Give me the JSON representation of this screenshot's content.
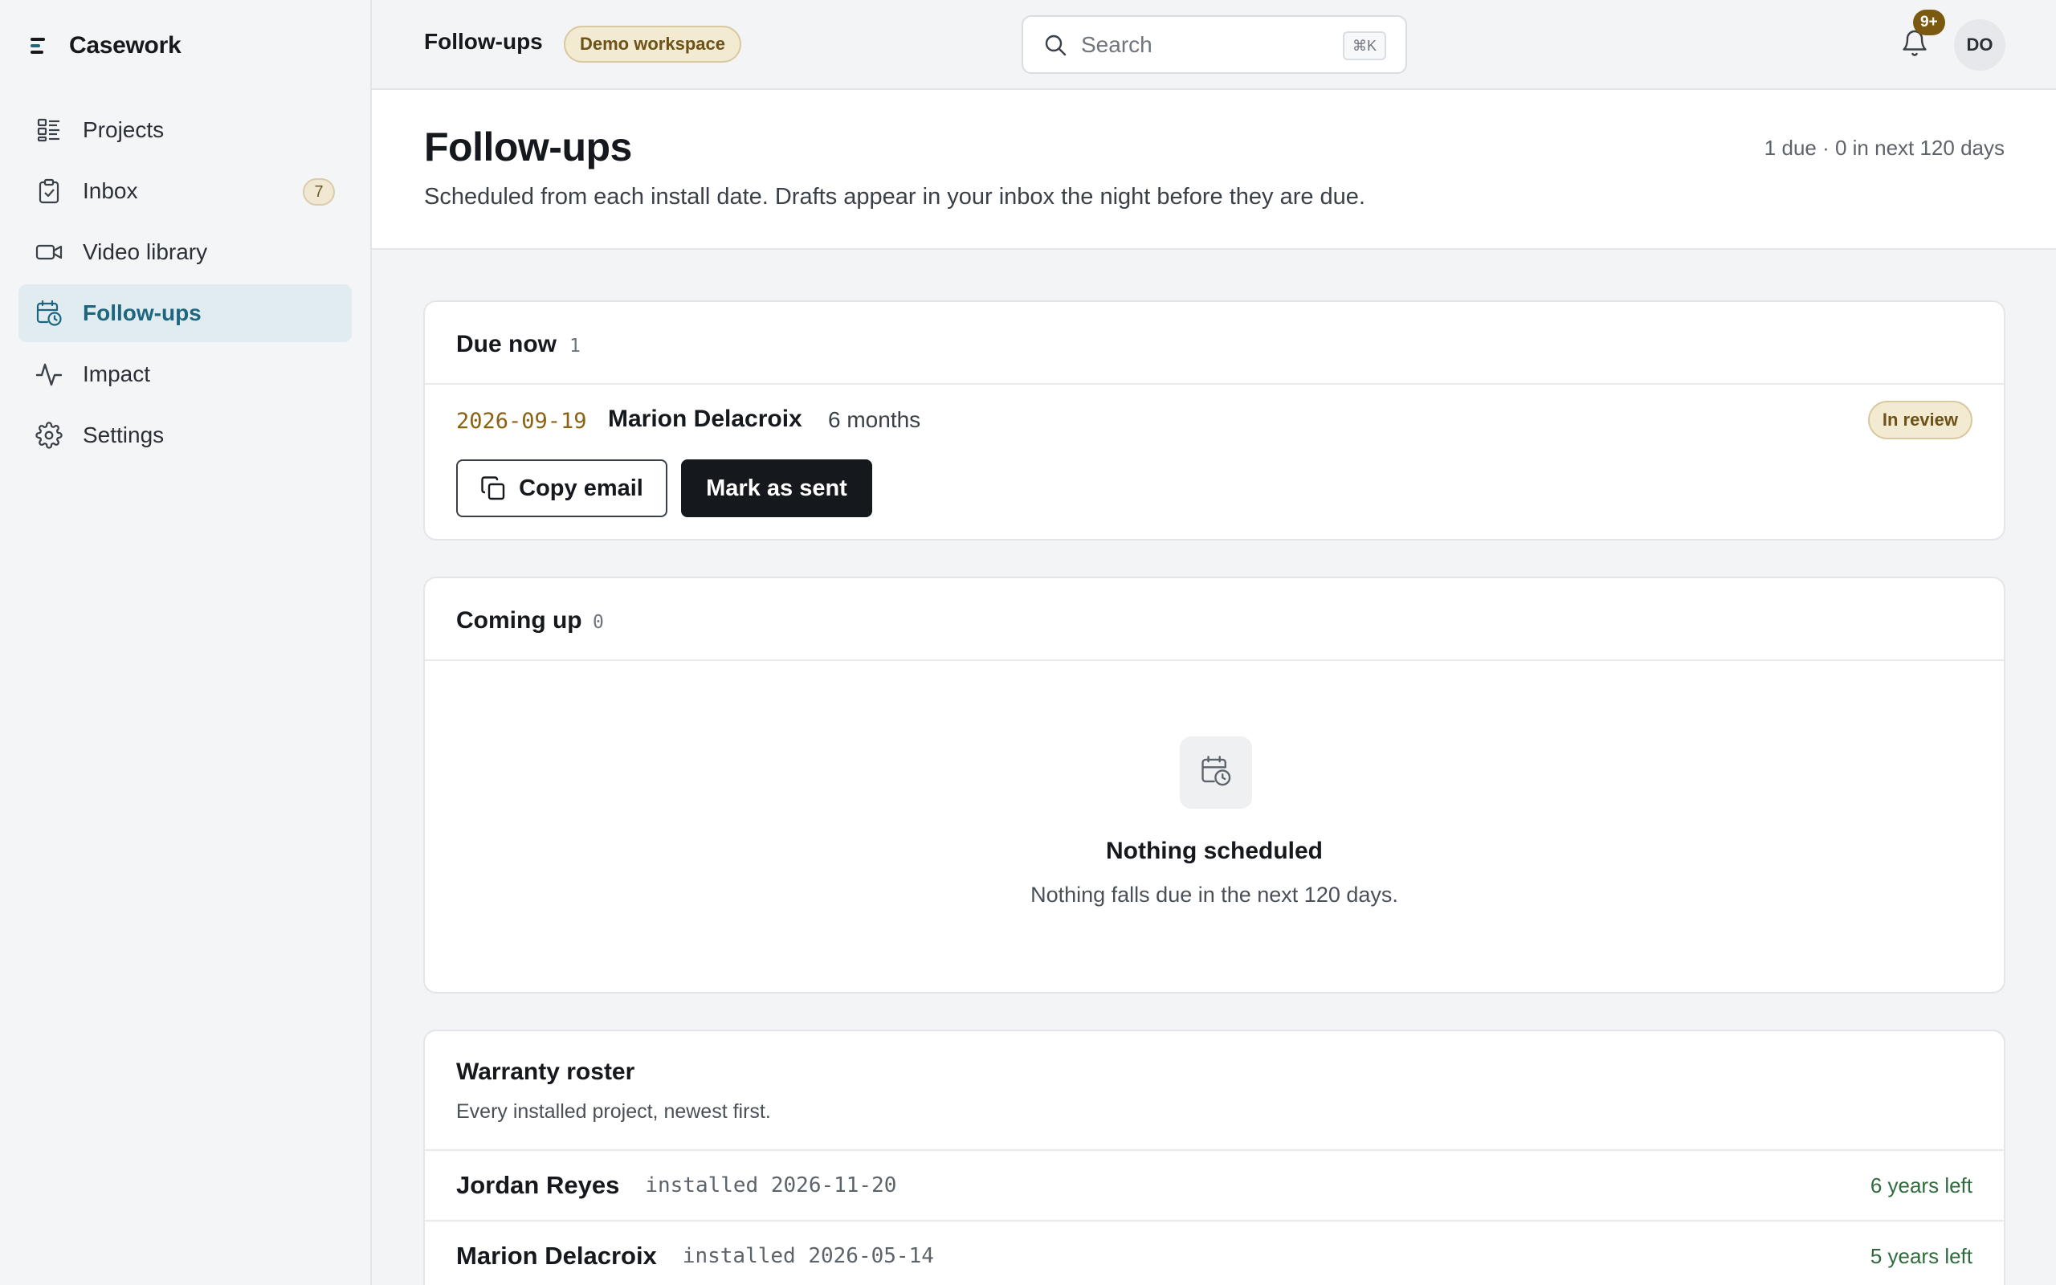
{
  "app": {
    "name": "Casework"
  },
  "sidebar": {
    "items": [
      {
        "label": "Projects",
        "icon": "projects-icon"
      },
      {
        "label": "Inbox",
        "icon": "inbox-icon",
        "count": "7"
      },
      {
        "label": "Video library",
        "icon": "video-icon"
      },
      {
        "label": "Follow-ups",
        "icon": "follow-ups-icon",
        "active": true
      },
      {
        "label": "Impact",
        "icon": "activity-icon"
      },
      {
        "label": "Settings",
        "icon": "gear-icon"
      }
    ]
  },
  "topbar": {
    "title": "Follow-ups",
    "workspace_badge": "Demo workspace",
    "search_placeholder": "Search",
    "search_shortcut": "⌘K",
    "notifications_badge": "9+",
    "avatar_initials": "DO"
  },
  "page": {
    "title": "Follow-ups",
    "subtitle": "Scheduled from each install date. Drafts appear in your inbox the night before they are due.",
    "stats": "1 due · 0 in next 120 days"
  },
  "due_now": {
    "title": "Due now",
    "count": "1",
    "item": {
      "date": "2026-09-19",
      "name": "Marion Delacroix",
      "period": "6 months",
      "status": "In review"
    },
    "copy_button": "Copy email",
    "sent_button": "Mark as sent"
  },
  "coming_up": {
    "title": "Coming up",
    "count": "0",
    "empty_title": "Nothing scheduled",
    "empty_text": "Nothing falls due in the next 120 days."
  },
  "roster": {
    "title": "Warranty roster",
    "subtitle": "Every installed project, newest first.",
    "rows": [
      {
        "name": "Jordan Reyes",
        "installed": "installed 2026-11-20",
        "left": "6 years left"
      },
      {
        "name": "Marion Delacroix",
        "installed": "installed 2026-05-14",
        "left": "5 years left"
      }
    ]
  },
  "colors": {
    "accent": "#1e6680",
    "active_bg": "#e1ecf1",
    "badge_bg": "#f3ead2",
    "badge_text": "#6d5217",
    "date_text": "#8a6312",
    "years_left_text": "#2f6b3d",
    "primary_button": "#15181c"
  }
}
